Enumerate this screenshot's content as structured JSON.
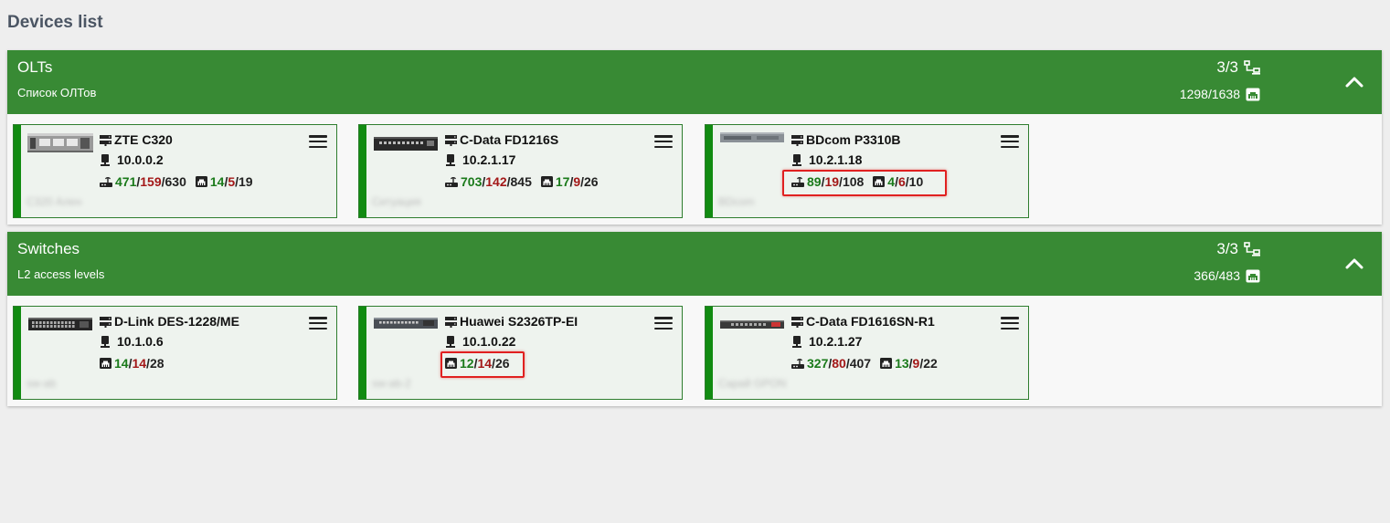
{
  "page_title": "Devices list",
  "groups": [
    {
      "title": "OLTs",
      "subtitle": "Список ОЛТов",
      "devices_count": "3/3",
      "ports_count": "1298/1638",
      "devices": [
        {
          "name": "ZTE C320",
          "ip": "10.0.0.2",
          "onu": {
            "online": "471",
            "offline": "159",
            "total": "630"
          },
          "ports": {
            "up": "14",
            "down": "5",
            "total": "19"
          },
          "description": "C320 Ален"
        },
        {
          "name": "C-Data FD1216S",
          "ip": "10.2.1.17",
          "onu": {
            "online": "703",
            "offline": "142",
            "total": "845"
          },
          "ports": {
            "up": "17",
            "down": "9",
            "total": "26"
          },
          "description": "Ситуация"
        },
        {
          "name": "BDcom P3310B",
          "ip": "10.2.1.18",
          "onu": {
            "online": "89",
            "offline": "19",
            "total": "108"
          },
          "ports": {
            "up": "4",
            "down": "6",
            "total": "10"
          },
          "description": "BDcom"
        }
      ]
    },
    {
      "title": "Switches",
      "subtitle": "L2 access levels",
      "devices_count": "3/3",
      "ports_count": "366/483",
      "devices": [
        {
          "name": "D-Link DES-1228/ME",
          "ip": "10.1.0.6",
          "ports": {
            "up": "14",
            "down": "14",
            "total": "28"
          },
          "description": "sw-ab"
        },
        {
          "name": "Huawei S2326TP-EI",
          "ip": "10.1.0.22",
          "ports": {
            "up": "12",
            "down": "14",
            "total": "26"
          },
          "description": "sw-ab-2"
        },
        {
          "name": "C-Data FD1616SN-R1",
          "ip": "10.2.1.27",
          "onu": {
            "online": "327",
            "offline": "80",
            "total": "407"
          },
          "ports": {
            "up": "13",
            "down": "9",
            "total": "22"
          },
          "description": "Сарай GPON"
        }
      ]
    }
  ]
}
